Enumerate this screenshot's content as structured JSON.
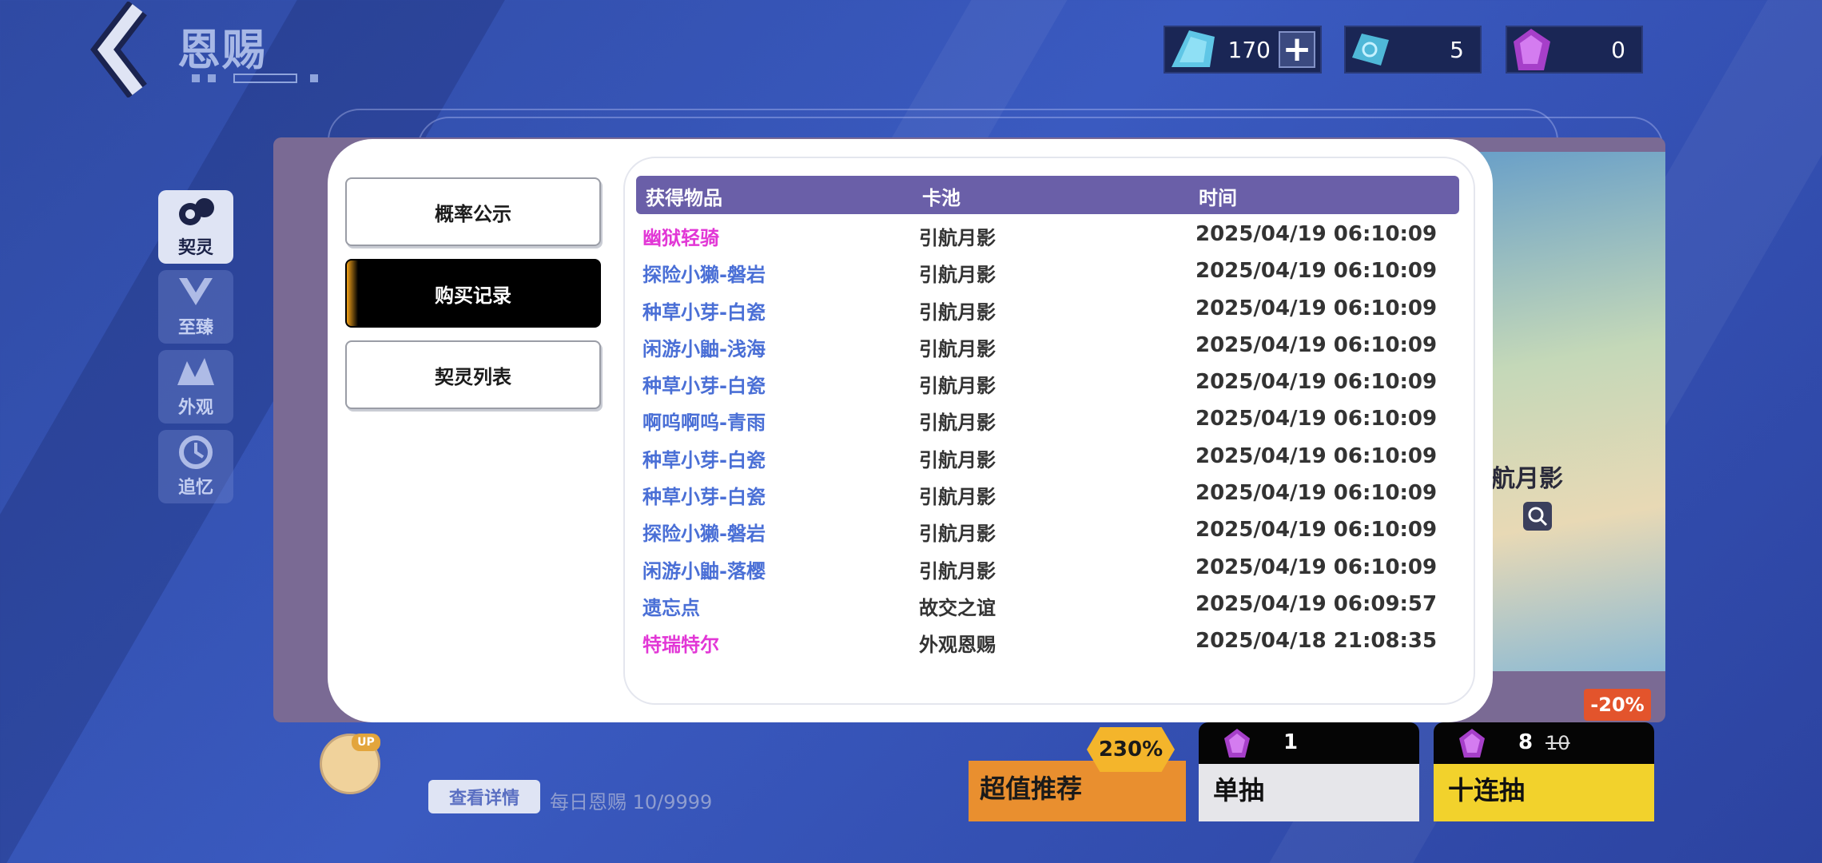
{
  "header": {
    "title": "恩赐",
    "currencies": [
      {
        "icon": "blue-crystal-icon",
        "value": "170"
      },
      {
        "icon": "blue-ticket-icon",
        "value": "5"
      },
      {
        "icon": "purple-gem-icon",
        "value": "0"
      }
    ]
  },
  "categories": [
    {
      "label": "契灵",
      "icon": "contract-spirit-icon"
    },
    {
      "label": "至臻",
      "icon": "supreme-icon"
    },
    {
      "label": "外观",
      "icon": "appearance-icon"
    },
    {
      "label": "追忆",
      "icon": "recollection-icon"
    }
  ],
  "modal": {
    "menu": [
      {
        "label": "概率公示"
      },
      {
        "label": "购买记录"
      },
      {
        "label": "契灵列表"
      }
    ],
    "table": {
      "headers": [
        "获得物品",
        "卡池",
        "时间"
      ],
      "rows": [
        {
          "item": "幽狱轻骑",
          "pool": "引航月影",
          "time": "2025/04/19 06:10:09"
        },
        {
          "item": "探险小獭-磐岩",
          "pool": "引航月影",
          "time": "2025/04/19 06:10:09"
        },
        {
          "item": "种草小芽-白瓷",
          "pool": "引航月影",
          "time": "2025/04/19 06:10:09"
        },
        {
          "item": "闲游小鼬-浅海",
          "pool": "引航月影",
          "time": "2025/04/19 06:10:09"
        },
        {
          "item": "种草小芽-白瓷",
          "pool": "引航月影",
          "time": "2025/04/19 06:10:09"
        },
        {
          "item": "啊呜啊呜-青雨",
          "pool": "引航月影",
          "time": "2025/04/19 06:10:09"
        },
        {
          "item": "种草小芽-白瓷",
          "pool": "引航月影",
          "time": "2025/04/19 06:10:09"
        },
        {
          "item": "种草小芽-白瓷",
          "pool": "引航月影",
          "time": "2025/04/19 06:10:09"
        },
        {
          "item": "探险小獭-磐岩",
          "pool": "引航月影",
          "time": "2025/04/19 06:10:09"
        },
        {
          "item": "闲游小鼬-落樱",
          "pool": "引航月影",
          "time": "2025/04/19 06:10:09"
        },
        {
          "item": "遗忘点",
          "pool": "故交之谊",
          "time": "2025/04/19 06:09:57"
        },
        {
          "item": "特瑞特尔",
          "pool": "外观恩赐",
          "time": "2025/04/18 21:08:35"
        }
      ]
    }
  },
  "background": {
    "banner_text": "航月影"
  },
  "bottom": {
    "up_badge": "UP",
    "detail_button": "查看详情",
    "daily_text": "每日恩赐 10/9999",
    "recommend_label": "超值推荐",
    "recommend_badge": "230%",
    "single_draw": {
      "label": "单抽",
      "cost": "1"
    },
    "ten_draw": {
      "label": "十连抽",
      "cost": "8",
      "original_cost": "10",
      "discount": "-20%"
    }
  },
  "colors": {
    "accent_orange": "#f3a21a",
    "table_header": "#6a5fa8",
    "item_blue": "#4a6fd6",
    "item_pink": "#e237d6"
  }
}
